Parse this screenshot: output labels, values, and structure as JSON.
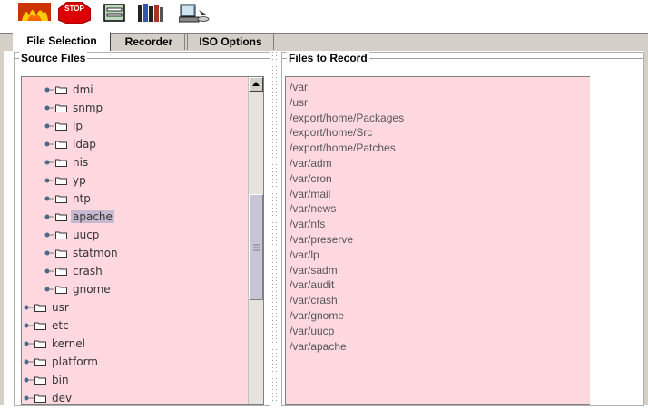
{
  "toolbar": {
    "buttons": [
      {
        "name": "fire-icon"
      },
      {
        "name": "stop-icon",
        "label": "STOP"
      },
      {
        "name": "panel-icon"
      },
      {
        "name": "books-icon"
      },
      {
        "name": "computer-disc-icon"
      }
    ]
  },
  "tabs": [
    {
      "label": "File Selection",
      "active": true
    },
    {
      "label": "Recorder",
      "active": false
    },
    {
      "label": "ISO Options",
      "active": false
    }
  ],
  "source_panel": {
    "title": "Source Files",
    "items": [
      {
        "label": "dmi",
        "depth": 1
      },
      {
        "label": "snmp",
        "depth": 1
      },
      {
        "label": "lp",
        "depth": 1
      },
      {
        "label": "ldap",
        "depth": 1
      },
      {
        "label": "nis",
        "depth": 1
      },
      {
        "label": "yp",
        "depth": 1
      },
      {
        "label": "ntp",
        "depth": 1
      },
      {
        "label": "apache",
        "depth": 1,
        "selected": true
      },
      {
        "label": "uucp",
        "depth": 1
      },
      {
        "label": "statmon",
        "depth": 1
      },
      {
        "label": "crash",
        "depth": 1
      },
      {
        "label": "gnome",
        "depth": 1
      },
      {
        "label": "usr",
        "depth": 0
      },
      {
        "label": "etc",
        "depth": 0
      },
      {
        "label": "kernel",
        "depth": 0
      },
      {
        "label": "platform",
        "depth": 0
      },
      {
        "label": "bin",
        "depth": 0
      },
      {
        "label": "dev",
        "depth": 0
      }
    ]
  },
  "record_panel": {
    "title": "Files to Record",
    "files": [
      "/var",
      "/usr",
      "/export/home/Packages",
      "/export/home/Src",
      "/export/home/Patches",
      "/var/adm",
      "/var/cron",
      "/var/mail",
      "/var/news",
      "/var/nfs",
      "/var/preserve",
      "/var/lp",
      "/var/sadm",
      "/var/audit",
      "/var/crash",
      "/var/gnome",
      "/var/uucp",
      "/var/apache"
    ]
  },
  "colors": {
    "list_bg": "#ffd9df",
    "selection": "#c5b9cf",
    "chrome": "#d4d0c8"
  }
}
